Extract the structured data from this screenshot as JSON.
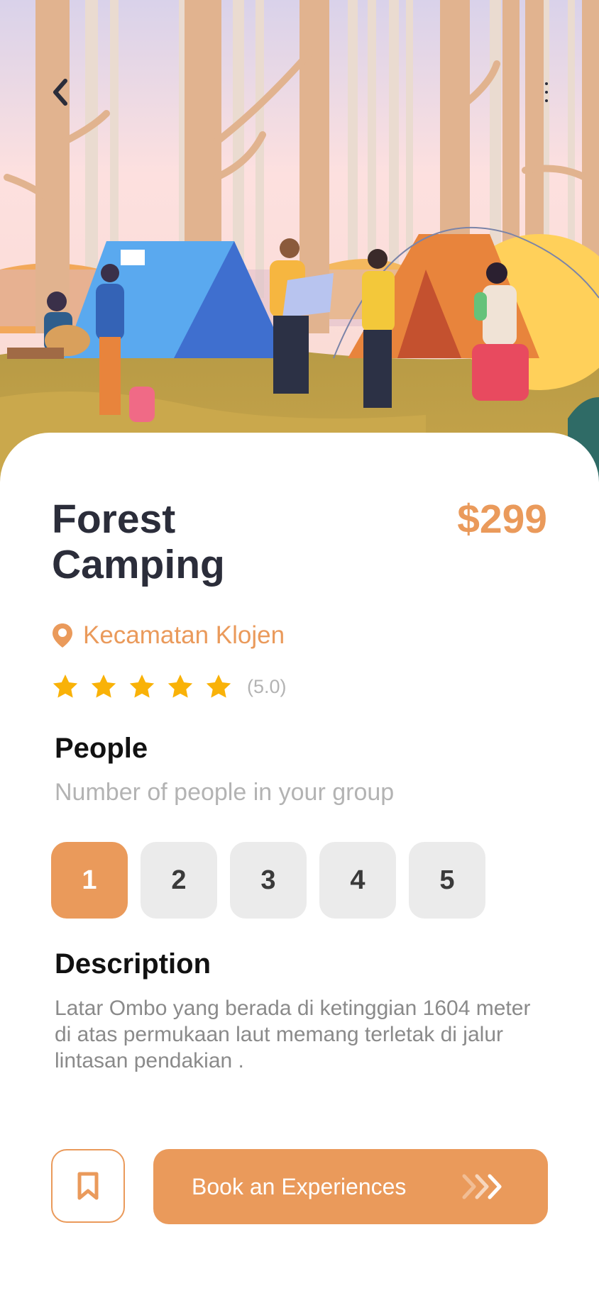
{
  "header": {
    "back_icon": "chevron-left-icon",
    "more_icon": "vertical-dots-icon"
  },
  "hero": {
    "illustration": "forest camping scene with tents, campers and trees"
  },
  "trip": {
    "title": "Forest Camping",
    "price": "$299",
    "location": "Kecamatan Klojen",
    "location_icon": "map-pin-icon",
    "rating": 5,
    "rating_text": "(5.0)"
  },
  "people": {
    "heading": "People",
    "subtitle": "Number of people in your group",
    "options": [
      "1",
      "2",
      "3",
      "4",
      "5"
    ],
    "selected": "1"
  },
  "description": {
    "heading": "Description",
    "text": "Latar Ombo yang berada di ketinggian 1604 meter di atas permukaan laut memang terletak di jalur lintasan pendakian ."
  },
  "footer": {
    "bookmark_icon": "bookmark-icon",
    "book_label": "Book an Experiences",
    "book_icon": "triple-chevron-right-icon"
  },
  "colors": {
    "accent": "#ea9a5b",
    "title": "#2b2d3a",
    "muted": "#b3b3b3",
    "star": "#f9b208",
    "chip": "#ebebeb"
  }
}
